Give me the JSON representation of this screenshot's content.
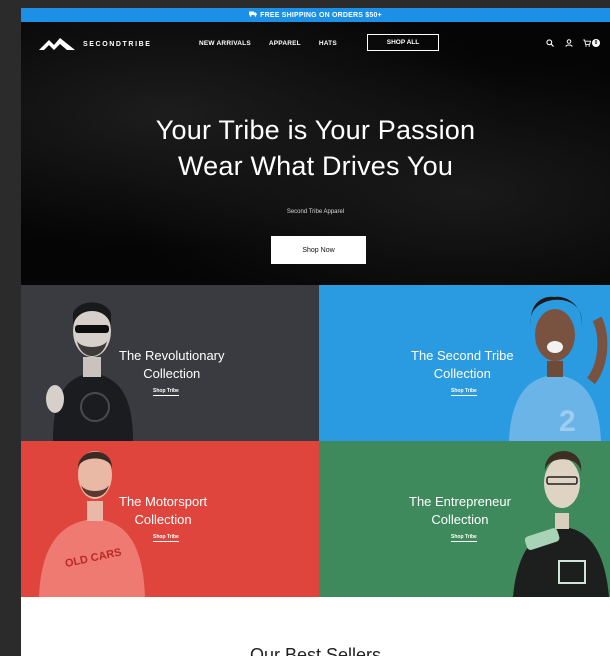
{
  "promo": {
    "icon": "truck-icon",
    "text": "FREE SHIPPING ON ORDERS $50+"
  },
  "nav": {
    "brand": "SECONDTRIBE",
    "links": [
      "NEW ARRIVALS",
      "APPAREL",
      "HATS"
    ],
    "shop_all": "SHOP ALL",
    "icons": [
      "search-icon",
      "user-icon",
      "cart-icon"
    ],
    "cart_count": "0"
  },
  "hero": {
    "title_line1": "Your Tribe is Your Passion",
    "title_line2": "Wear What Drives You",
    "subtitle": "Second Tribe Apparel",
    "button": "Shop Now"
  },
  "collections": [
    {
      "line1": "The Revolutionary",
      "line2": "Collection",
      "link": "Shop Tribe",
      "color": "#3a3b40"
    },
    {
      "line1": "The Second Tribe",
      "line2": "Collection",
      "link": "Shop Tribe",
      "color": "#2a9be0"
    },
    {
      "line1": "The Motorsport",
      "line2": "Collection",
      "link": "Shop Tribe",
      "color": "#e0453d"
    },
    {
      "line1": "The Entrepreneur",
      "line2": "Collection",
      "link": "Shop Tribe",
      "color": "#3f8a5c"
    }
  ],
  "best_sellers": {
    "title": "Our Best Sellers"
  }
}
